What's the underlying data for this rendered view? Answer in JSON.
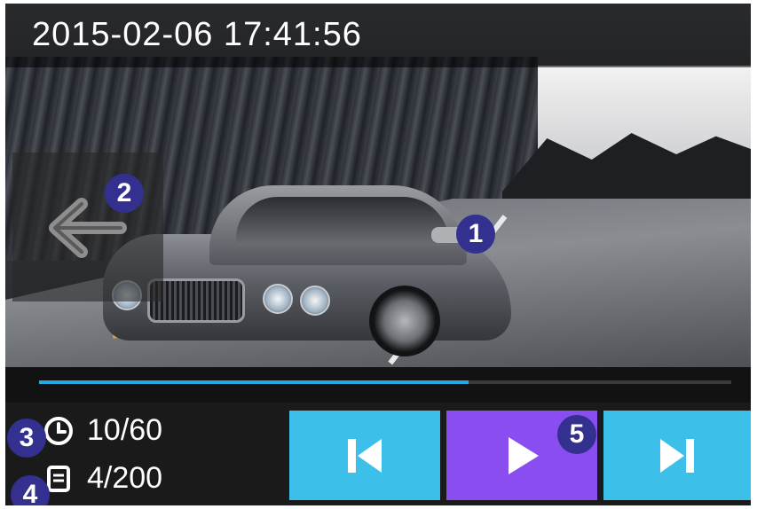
{
  "header": {
    "timestamp": "2015-02-06   17:41:56"
  },
  "playback": {
    "progress_fraction": 0.62,
    "time_counter": "10/60",
    "file_counter": "4/200"
  },
  "markers": [
    "1",
    "2",
    "3",
    "4",
    "5"
  ],
  "icons": {
    "back": "arrow-left-icon",
    "clock": "clock-icon",
    "file": "file-list-icon",
    "prev": "skip-previous-icon",
    "play": "play-icon",
    "next": "skip-next-icon"
  },
  "colors": {
    "accent_blue": "#3cc0ea",
    "play_purple": "#8a4ef0",
    "marker": "#33308f",
    "progress": "#29a7e0"
  }
}
